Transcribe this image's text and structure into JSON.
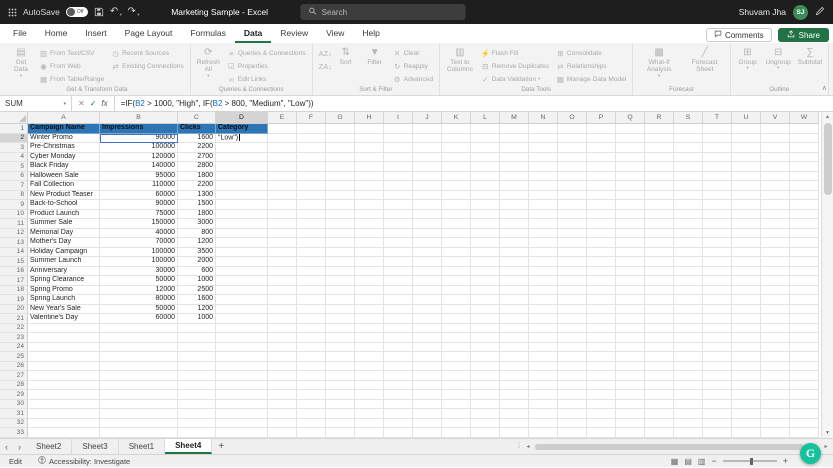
{
  "title_bar": {
    "autosave_label": "AutoSave",
    "autosave_state": "Off",
    "document_title": "Marketing Sample - Excel",
    "search_placeholder": "Search",
    "user_name": "Shuvam Jha",
    "avatar_initials": "SJ"
  },
  "ribbon": {
    "tabs": [
      "File",
      "Home",
      "Insert",
      "Page Layout",
      "Formulas",
      "Data",
      "Review",
      "View",
      "Help"
    ],
    "active_tab": "Data",
    "comments_label": "Comments",
    "share_label": "Share",
    "groups": [
      {
        "label": "Get & Transform Data",
        "buttons": [
          {
            "label": "Get Data",
            "type": "big",
            "icon": "get-data",
            "glyph": "▤",
            "arrow": true
          },
          {
            "label": "From Text/CSV",
            "type": "small",
            "icon": "from-text-csv",
            "glyph": "▥"
          },
          {
            "label": "From Web",
            "type": "small",
            "icon": "from-web",
            "glyph": "◉"
          },
          {
            "label": "From Table/Range",
            "type": "small",
            "icon": "from-table-range",
            "glyph": "▦"
          },
          {
            "label": "Recent Sources",
            "type": "small",
            "icon": "recent-sources",
            "glyph": "◷",
            "newcol": true
          },
          {
            "label": "Existing Connections",
            "type": "small",
            "icon": "existing-connections",
            "glyph": "⇄"
          }
        ]
      },
      {
        "label": "Queries & Connections",
        "buttons": [
          {
            "label": "Refresh All",
            "type": "big",
            "icon": "refresh-all",
            "glyph": "⟳",
            "arrow": true
          },
          {
            "label": "Queries & Connections",
            "type": "small",
            "icon": "queries-connections",
            "glyph": "≡"
          },
          {
            "label": "Properties",
            "type": "small",
            "icon": "properties",
            "glyph": "☑"
          },
          {
            "label": "Edit Links",
            "type": "small",
            "icon": "edit-links",
            "glyph": "∞"
          }
        ]
      },
      {
        "label": "Sort & Filter",
        "buttons": [
          {
            "label": "",
            "type": "small",
            "icon": "sort-az",
            "glyph": "AZ↓"
          },
          {
            "label": "",
            "type": "small",
            "icon": "sort-za",
            "glyph": "ZA↓"
          },
          {
            "label": "Sort",
            "type": "big",
            "icon": "sort",
            "glyph": "⇅"
          },
          {
            "label": "Filter",
            "type": "big",
            "icon": "filter",
            "glyph": "▼"
          },
          {
            "label": "Clear",
            "type": "small",
            "icon": "clear-filter",
            "glyph": "✕"
          },
          {
            "label": "Reapply",
            "type": "small",
            "icon": "reapply",
            "glyph": "↻"
          },
          {
            "label": "Advanced",
            "type": "small",
            "icon": "advanced-filter",
            "glyph": "⚙"
          }
        ]
      },
      {
        "label": "Data Tools",
        "buttons": [
          {
            "label": "Text to Columns",
            "type": "big",
            "icon": "text-to-columns",
            "glyph": "▥"
          },
          {
            "label": "Flash Fill",
            "type": "small",
            "icon": "flash-fill",
            "glyph": "⚡"
          },
          {
            "label": "Remove Duplicates",
            "type": "small",
            "icon": "remove-duplicates",
            "glyph": "⊟"
          },
          {
            "label": "Data Validation",
            "type": "small",
            "icon": "data-validation",
            "glyph": "✓",
            "arrow": true
          },
          {
            "label": "Consolidate",
            "type": "small",
            "icon": "consolidate",
            "glyph": "⊞",
            "newcol": true
          },
          {
            "label": "Relationships",
            "type": "small",
            "icon": "relationships",
            "glyph": "⇄"
          },
          {
            "label": "Manage Data Model",
            "type": "small",
            "icon": "manage-data-model",
            "glyph": "▦"
          }
        ]
      },
      {
        "label": "Forecast",
        "buttons": [
          {
            "label": "What-If Analysis",
            "type": "big",
            "icon": "what-if-analysis",
            "glyph": "▩",
            "arrow": true
          },
          {
            "label": "Forecast Sheet",
            "type": "big",
            "icon": "forecast-sheet",
            "glyph": "╱"
          }
        ]
      },
      {
        "label": "Outline",
        "buttons": [
          {
            "label": "Group",
            "type": "big",
            "icon": "group",
            "glyph": "⊞",
            "arrow": true
          },
          {
            "label": "Ungroup",
            "type": "big",
            "icon": "ungroup",
            "glyph": "⊟",
            "arrow": true
          },
          {
            "label": "Subtotal",
            "type": "big",
            "icon": "subtotal",
            "glyph": "∑"
          }
        ]
      }
    ]
  },
  "formula_bar": {
    "name_box_value": "SUM",
    "formula_segments": [
      {
        "text": "=IF(",
        "color": "#1f1f1f"
      },
      {
        "text": "B2",
        "color": "#0f6cbd"
      },
      {
        "text": " > 1000, \"High\", IF(",
        "color": "#1f1f1f"
      },
      {
        "text": "B2",
        "color": "#0f6cbd"
      },
      {
        "text": " > 800, \"Medium\", \"Low\"))",
        "color": "#1f1f1f"
      }
    ]
  },
  "grid": {
    "columns": [
      "A",
      "B",
      "C",
      "D",
      "E",
      "F",
      "G",
      "H",
      "I",
      "J",
      "K",
      "L",
      "M",
      "N",
      "O",
      "P",
      "Q",
      "R",
      "S",
      "T",
      "U",
      "V",
      "W"
    ],
    "column_widths": {
      "A": 72,
      "B": 78,
      "C": 38,
      "D": 52,
      "default": 29
    },
    "row_count": 33,
    "selected_column": "D",
    "selected_row": 2,
    "reference_cell": "B2",
    "header_fill_color": "#2e75b6",
    "header_row": [
      "Campaign Name",
      "Impressions",
      "Clicks",
      "Category"
    ],
    "editing_cell": "D2",
    "editing_cell_text": "\"Low\")",
    "rows": [
      {
        "name": "Winter Promo",
        "impressions": 90000,
        "clicks": 1600
      },
      {
        "name": "Pre-Christmas",
        "impressions": 100000,
        "clicks": 2200
      },
      {
        "name": "Cyber Monday",
        "impressions": 120000,
        "clicks": 2700
      },
      {
        "name": "Black Friday",
        "impressions": 140000,
        "clicks": 2800
      },
      {
        "name": "Halloween Sale",
        "impressions": 95000,
        "clicks": 1800
      },
      {
        "name": "Fall Collection",
        "impressions": 110000,
        "clicks": 2200
      },
      {
        "name": "New Product Teaser",
        "impressions": 60000,
        "clicks": 1300
      },
      {
        "name": "Back-to-School",
        "impressions": 90000,
        "clicks": 1500
      },
      {
        "name": "Product Launch",
        "impressions": 75000,
        "clicks": 1800
      },
      {
        "name": "Summer Sale",
        "impressions": 150000,
        "clicks": 3000
      },
      {
        "name": "Memorial Day",
        "impressions": 40000,
        "clicks": 800
      },
      {
        "name": "Mother's Day",
        "impressions": 70000,
        "clicks": 1200
      },
      {
        "name": "Holiday Campaign",
        "impressions": 100000,
        "clicks": 3500
      },
      {
        "name": "Summer Launch",
        "impressions": 100000,
        "clicks": 2000
      },
      {
        "name": "Anniversary",
        "impressions": 30000,
        "clicks": 600
      },
      {
        "name": "Spring Clearance",
        "impressions": 50000,
        "clicks": 1000
      },
      {
        "name": "Spring Promo",
        "impressions": 12000,
        "clicks": 2500
      },
      {
        "name": "Spring Launch",
        "impressions": 80000,
        "clicks": 1600
      },
      {
        "name": "New Year's Sale",
        "impressions": 50000,
        "clicks": 1200
      },
      {
        "name": "Valentine's Day",
        "impressions": 60000,
        "clicks": 1000
      }
    ]
  },
  "sheet_tabs": {
    "tabs": [
      "Sheet2",
      "Sheet3",
      "Sheet1",
      "Sheet4"
    ],
    "active_tab": "Sheet4",
    "add_sheet_label": "+"
  },
  "status_bar": {
    "mode": "Edit",
    "accessibility_label": "Accessibility: Investigate"
  },
  "overlay": {
    "grammarly_label": "G"
  },
  "colors": {
    "excel_green": "#217346",
    "header_fill": "#2e75b6",
    "reference_border": "#4472c4",
    "grammarly_green": "#15c39a"
  }
}
